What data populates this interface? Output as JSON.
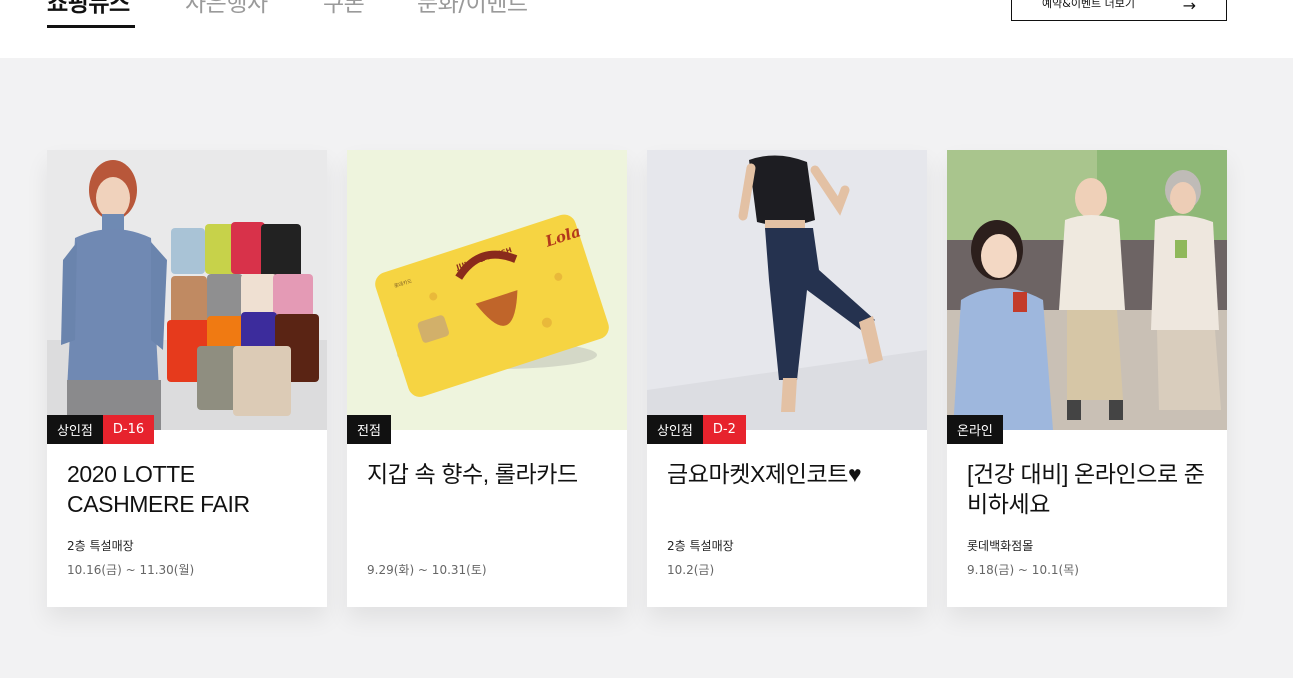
{
  "tabs": [
    {
      "label": "쇼핑뉴스",
      "active": true
    },
    {
      "label": "사은행사",
      "active": false
    },
    {
      "label": "쿠폰",
      "active": false
    },
    {
      "label": "문화/이벤트",
      "active": false
    }
  ],
  "reserve_button": {
    "label": "예약&이벤트 더보기",
    "icon": "arrow-right-icon"
  },
  "cards": [
    {
      "store": "상인점",
      "dday": "D-16",
      "title": "2020 LOTTE CASHMERE FAIR",
      "place": "2층 특설매장",
      "date": "10.16(금) ~ 11.30(월)",
      "image": "cashmere-sweaters-photo"
    },
    {
      "store": "전점",
      "dday": "",
      "title": "지갑 속 향수, 롤라카드",
      "place": "",
      "date": "9.29(화) ~ 10.31(토)",
      "image": "lola-card-photo",
      "card_art": {
        "brand": "Lola",
        "badge_text": "JUICY & FRESH",
        "issuer": "롯데카드"
      }
    },
    {
      "store": "상인점",
      "dday": "D-2",
      "title": "금요마켓X제인코트♥",
      "place": "2층 특설매장",
      "date": "10.2(금)",
      "image": "leggings-model-photo"
    },
    {
      "store": "온라인",
      "dday": "",
      "title": "[건강 대비] 온라인으로 준비하세요",
      "place": "롯데백화점몰",
      "date": "9.18(금) ~ 10.1(목)",
      "image": "family-health-photo"
    }
  ],
  "colors": {
    "badge_dark": "#111111",
    "badge_dday": "#e7232d",
    "background": "#f2f2f3"
  }
}
